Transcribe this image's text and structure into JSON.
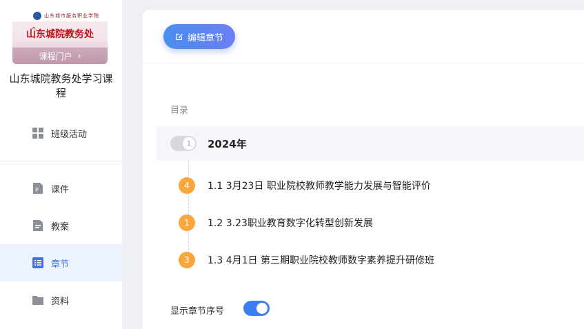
{
  "sidebar": {
    "cover": {
      "school_name": "山东城市服务职业学院",
      "title": "山东城院教务处",
      "enter_label": "课程门户"
    },
    "course_name": "山东城院教务处学习课程",
    "items": [
      {
        "label": "班级活动",
        "icon": "grid-icon"
      },
      {
        "label": "课件",
        "icon": "ppt-file-icon"
      },
      {
        "label": "教案",
        "icon": "lesson-plan-icon"
      },
      {
        "label": "章节",
        "icon": "list-icon",
        "active": true
      },
      {
        "label": "资料",
        "icon": "folder-icon"
      }
    ]
  },
  "main": {
    "edit_button_label": "编辑章节",
    "toc_label": "目录",
    "chapter": {
      "badge": "1",
      "title": "2024年"
    },
    "sections": [
      {
        "count": "4",
        "title": "1.1 3月23日 职业院校教师教学能力发展与智能评价"
      },
      {
        "count": "1",
        "title": "1.2 3.23职业教育数字化转型创新发展"
      },
      {
        "count": "3",
        "title": "1.3 4月1日 第三期职业院校教师数字素养提升研修班"
      }
    ],
    "show_number_label": "显示章节序号",
    "show_number_enabled": true
  },
  "colors": {
    "accent": "#3b7ff0",
    "active_bg": "#edf3fd",
    "badge_orange": "#f8a73d"
  }
}
